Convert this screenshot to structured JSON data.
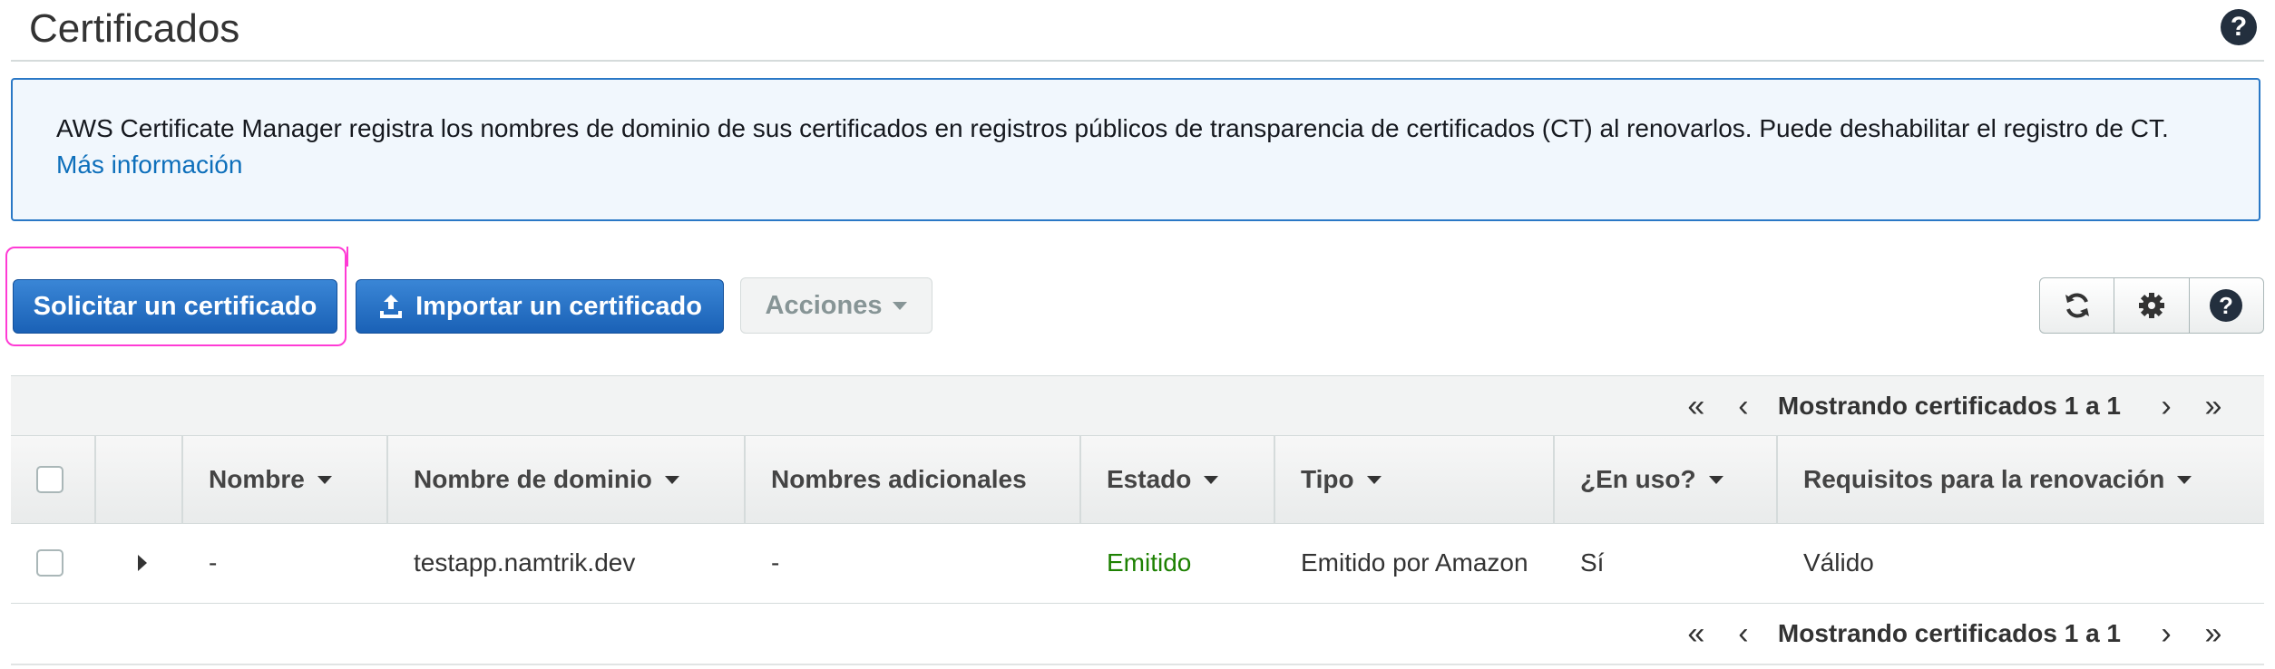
{
  "header": {
    "title": "Certificados",
    "help_icon": "help-circle-icon"
  },
  "info": {
    "text": "AWS Certificate Manager registra los nombres de dominio de sus certificados en registros públicos de transparencia de certificados (CT) al renovarlos. Puede deshabilitar el registro de CT.",
    "link": "Más información"
  },
  "toolbar": {
    "request_label": "Solicitar un certificado",
    "import_label": "Importar un certificado",
    "import_icon": "upload-icon",
    "actions_label": "Acciones",
    "tools": [
      "refresh-icon",
      "gear-icon",
      "help-circle-icon"
    ]
  },
  "pager": {
    "text": "Mostrando certificados 1 a 1",
    "first": "«",
    "prev": "‹",
    "next": "›",
    "last": "»"
  },
  "table": {
    "columns": [
      "Nombre",
      "Nombre de dominio",
      "Nombres adicionales",
      "Estado",
      "Tipo",
      "¿En uso?",
      "Requisitos para la renovación"
    ],
    "rows": [
      {
        "name": "-",
        "domain": "testapp.namtrik.dev",
        "additional": "-",
        "status": "Emitido",
        "type": "Emitido por Amazon",
        "in_use": "Sí",
        "renewal": "Válido"
      }
    ]
  },
  "colors": {
    "primary": "#1a61b6",
    "link": "#0d6fbb",
    "status_ok": "#1d8102",
    "annotation": "#ff3bd5"
  }
}
